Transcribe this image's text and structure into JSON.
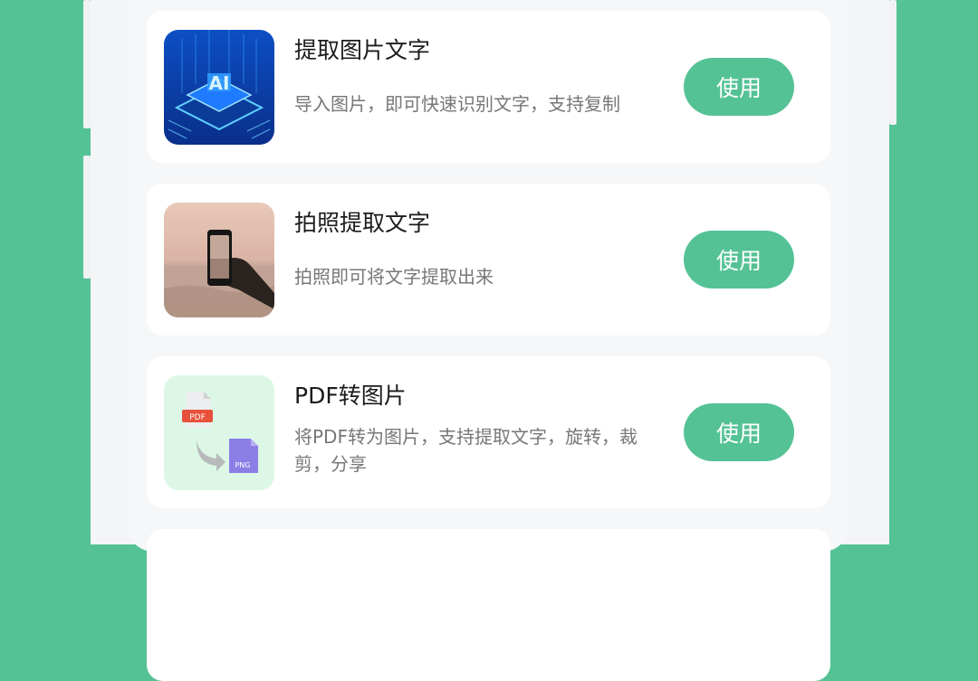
{
  "colors": {
    "accent": "#54c295",
    "card": "#ffffff",
    "sheet": "#f6f7f9"
  },
  "tools": [
    {
      "title": "提取图片文字",
      "description": "导入图片，即可快速识别文字，支持复制",
      "button_label": "使用",
      "icon": "ai-chip-image-icon",
      "icon_text": "AI"
    },
    {
      "title": "拍照提取文字",
      "description": "拍照即可将文字提取出来",
      "button_label": "使用",
      "icon": "camera-photo-icon"
    },
    {
      "title": "PDF转图片",
      "description": "将PDF转为图片，支持提取文字，旋转，裁剪，分享",
      "button_label": "使用",
      "icon": "pdf-to-png-icon",
      "icon_labels": {
        "pdf": "PDF",
        "png": "PNG"
      }
    }
  ]
}
